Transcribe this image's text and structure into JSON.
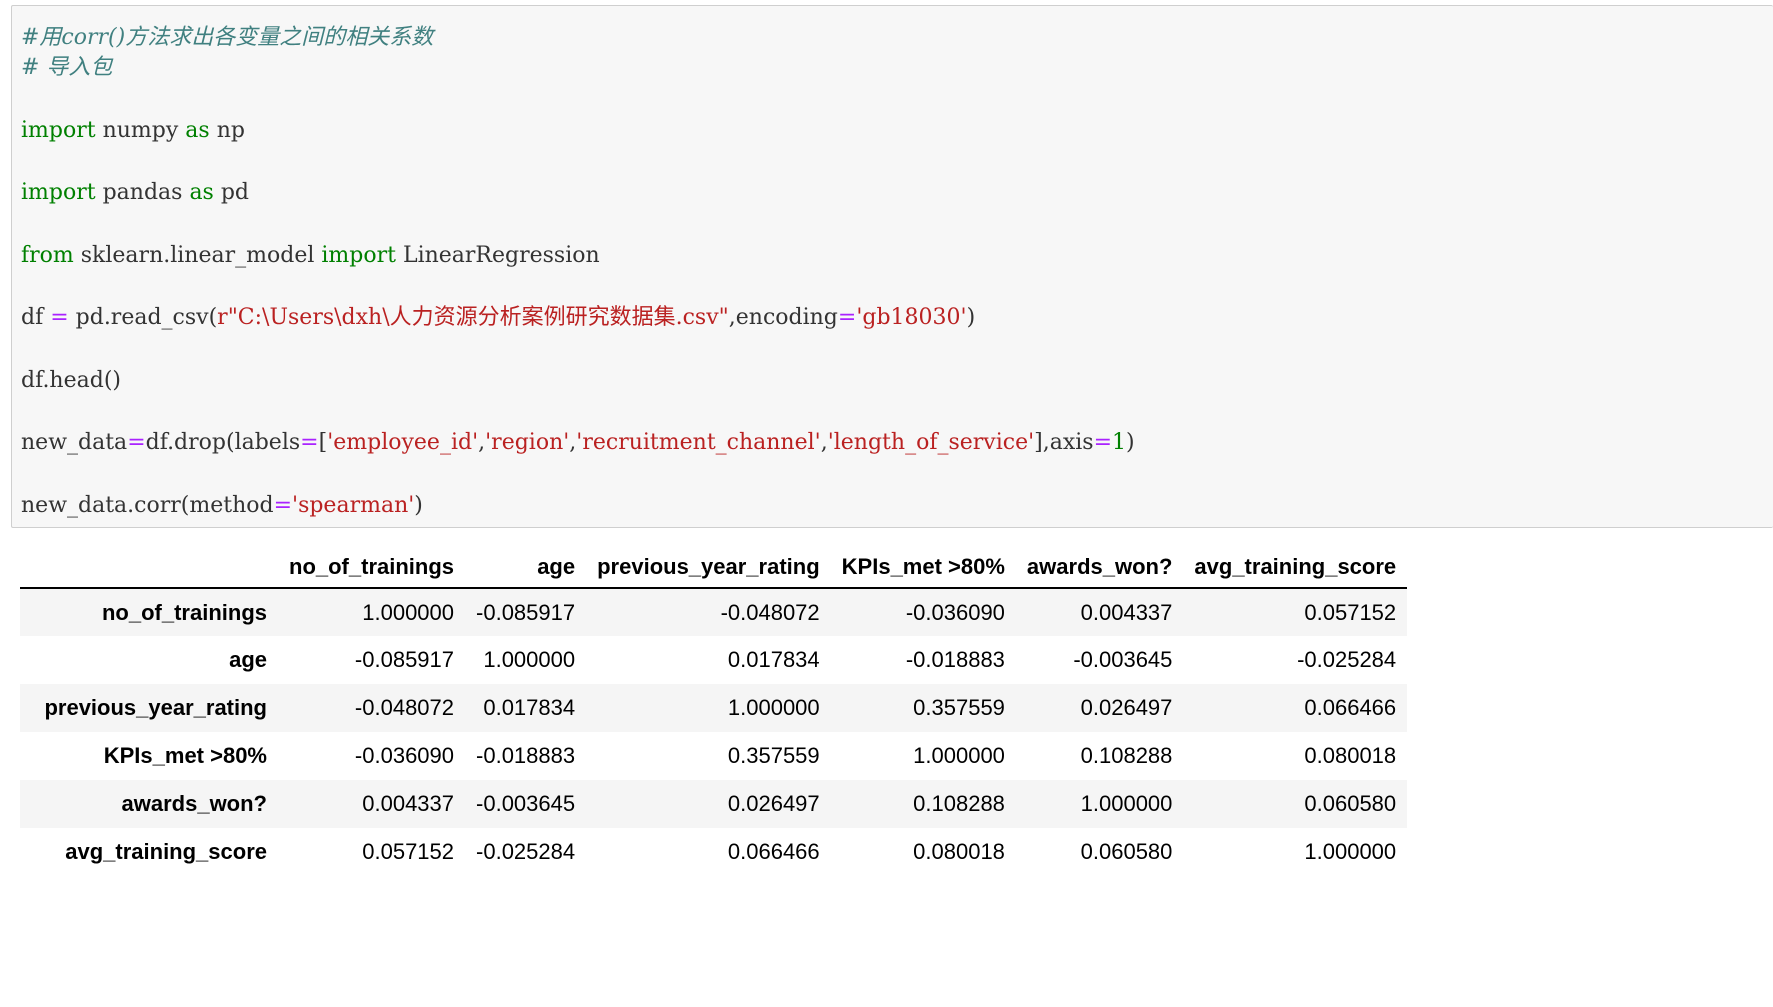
{
  "code": {
    "comment1": "#用corr()方法求出各变量之间的相关系数",
    "comment2": "# 导入包",
    "line_import_numpy": {
      "kw1": "import",
      "mod": " numpy ",
      "kw2": "as",
      "alias": " np"
    },
    "line_import_pandas": {
      "kw1": "import",
      "mod": " pandas ",
      "kw2": "as",
      "alias": " pd"
    },
    "line_from": {
      "kw1": "from",
      "mod": " sklearn.linear_model ",
      "kw2": "import",
      "name": " LinearRegression"
    },
    "line_read": {
      "lhs": "df ",
      "op": "=",
      "call": " pd.read_csv(",
      "path": "r\"C:\\Users\\dxh\\人力资源分析案例研究数据集.csv\"",
      "kwarg": ",encoding",
      "op2": "=",
      "enc": "'gb18030'",
      "close": ")"
    },
    "line_head": "df.head()",
    "line_drop": {
      "lhs": "new_data",
      "op": "=",
      "call": "df.drop(labels",
      "op2": "=",
      "open": "[",
      "s1": "'employee_id'",
      "sep1": ",",
      "s2": "'region'",
      "sep2": ",",
      "s3": "'recruitment_channel'",
      "sep3": ",",
      "s4": "'length_of_service'",
      "close": "],axis",
      "op3": "=",
      "num": "1",
      "end": ")"
    },
    "line_corr": {
      "call": "new_data.corr(method",
      "op": "=",
      "str": "'spearman'",
      "end": ")"
    }
  },
  "output_table": {
    "columns": [
      "no_of_trainings",
      "age",
      "previous_year_rating",
      "KPIs_met >80%",
      "awards_won?",
      "avg_training_score"
    ],
    "rows": [
      {
        "label": "no_of_trainings",
        "values": [
          "1.000000",
          "-0.085917",
          "-0.048072",
          "-0.036090",
          "0.004337",
          "0.057152"
        ]
      },
      {
        "label": "age",
        "values": [
          "-0.085917",
          "1.000000",
          "0.017834",
          "-0.018883",
          "-0.003645",
          "-0.025284"
        ]
      },
      {
        "label": "previous_year_rating",
        "values": [
          "-0.048072",
          "0.017834",
          "1.000000",
          "0.357559",
          "0.026497",
          "0.066466"
        ]
      },
      {
        "label": "KPIs_met >80%",
        "values": [
          "-0.036090",
          "-0.018883",
          "0.357559",
          "1.000000",
          "0.108288",
          "0.080018"
        ]
      },
      {
        "label": "awards_won?",
        "values": [
          "0.004337",
          "-0.003645",
          "0.026497",
          "0.108288",
          "1.000000",
          "0.060580"
        ]
      },
      {
        "label": "avg_training_score",
        "values": [
          "0.057152",
          "-0.025284",
          "0.066466",
          "0.080018",
          "0.060580",
          "1.000000"
        ]
      }
    ]
  },
  "colors": {
    "cell_background": "#f7f7f7",
    "cell_border": "#cfcfcf",
    "keyword": "#008000",
    "string": "#ba2121",
    "operator": "#aa22ff",
    "comment": "#408080",
    "row_stripe": "#f5f5f5"
  }
}
